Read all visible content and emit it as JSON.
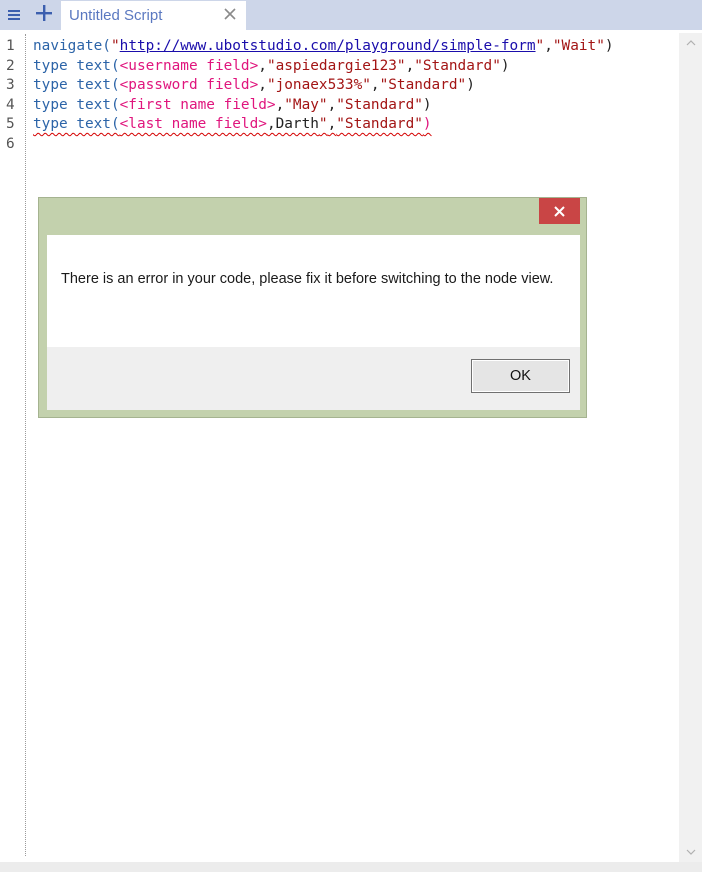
{
  "tab_bar": {
    "menu_icon": "hamburger-icon",
    "add_icon": "plus-icon",
    "tab_title": "Untitled Script",
    "close_icon": "close-icon"
  },
  "editor": {
    "line_numbers": [
      "1",
      "2",
      "3",
      "4",
      "5",
      "6"
    ],
    "lines": [
      [
        {
          "text": "navigate(",
          "cls": "kw"
        },
        {
          "text": "\"",
          "cls": "str"
        },
        {
          "text": "http://www.ubotstudio.com/playground/simple-form",
          "cls": "url"
        },
        {
          "text": "\"",
          "cls": "str"
        },
        {
          "text": ",",
          "cls": "plain"
        },
        {
          "text": "\"Wait\"",
          "cls": "str"
        },
        {
          "text": ")",
          "cls": "plain"
        }
      ],
      [
        {
          "text": "type text(",
          "cls": "kw"
        },
        {
          "text": "<username field>",
          "cls": "elem"
        },
        {
          "text": ",",
          "cls": "plain"
        },
        {
          "text": "\"aspiedargie123\"",
          "cls": "str"
        },
        {
          "text": ",",
          "cls": "plain"
        },
        {
          "text": "\"Standard\"",
          "cls": "str"
        },
        {
          "text": ")",
          "cls": "plain"
        }
      ],
      [
        {
          "text": "type text(",
          "cls": "kw"
        },
        {
          "text": "<password field>",
          "cls": "elem"
        },
        {
          "text": ",",
          "cls": "plain"
        },
        {
          "text": "\"jonaex533%\"",
          "cls": "str"
        },
        {
          "text": ",",
          "cls": "plain"
        },
        {
          "text": "\"Standard\"",
          "cls": "str"
        },
        {
          "text": ")",
          "cls": "plain"
        }
      ],
      [
        {
          "text": "type text(",
          "cls": "kw"
        },
        {
          "text": "<first name field>",
          "cls": "elem"
        },
        {
          "text": ",",
          "cls": "plain"
        },
        {
          "text": "\"May\"",
          "cls": "str"
        },
        {
          "text": ",",
          "cls": "plain"
        },
        {
          "text": "\"Standard\"",
          "cls": "str"
        },
        {
          "text": ")",
          "cls": "plain"
        }
      ],
      [
        {
          "text": "type text(",
          "cls": "kw err"
        },
        {
          "text": "<last name field>",
          "cls": "elem err"
        },
        {
          "text": ",Darth",
          "cls": "plain err"
        },
        {
          "text": "\"",
          "cls": "str err"
        },
        {
          "text": ",",
          "cls": "plain err"
        },
        {
          "text": "\"Standard\"",
          "cls": "str err"
        },
        {
          "text": ")",
          "cls": "elem err"
        }
      ],
      []
    ]
  },
  "dialog": {
    "message": "There is an error in your code, please fix it before switching to the node view.",
    "ok_label": "OK",
    "close_icon": "close-icon",
    "title_bar_color": "#c3d1ad",
    "close_color": "#c94545"
  },
  "scrollbar": {
    "up_icon": "chevron-up-icon",
    "down_icon": "chevron-down-icon"
  }
}
